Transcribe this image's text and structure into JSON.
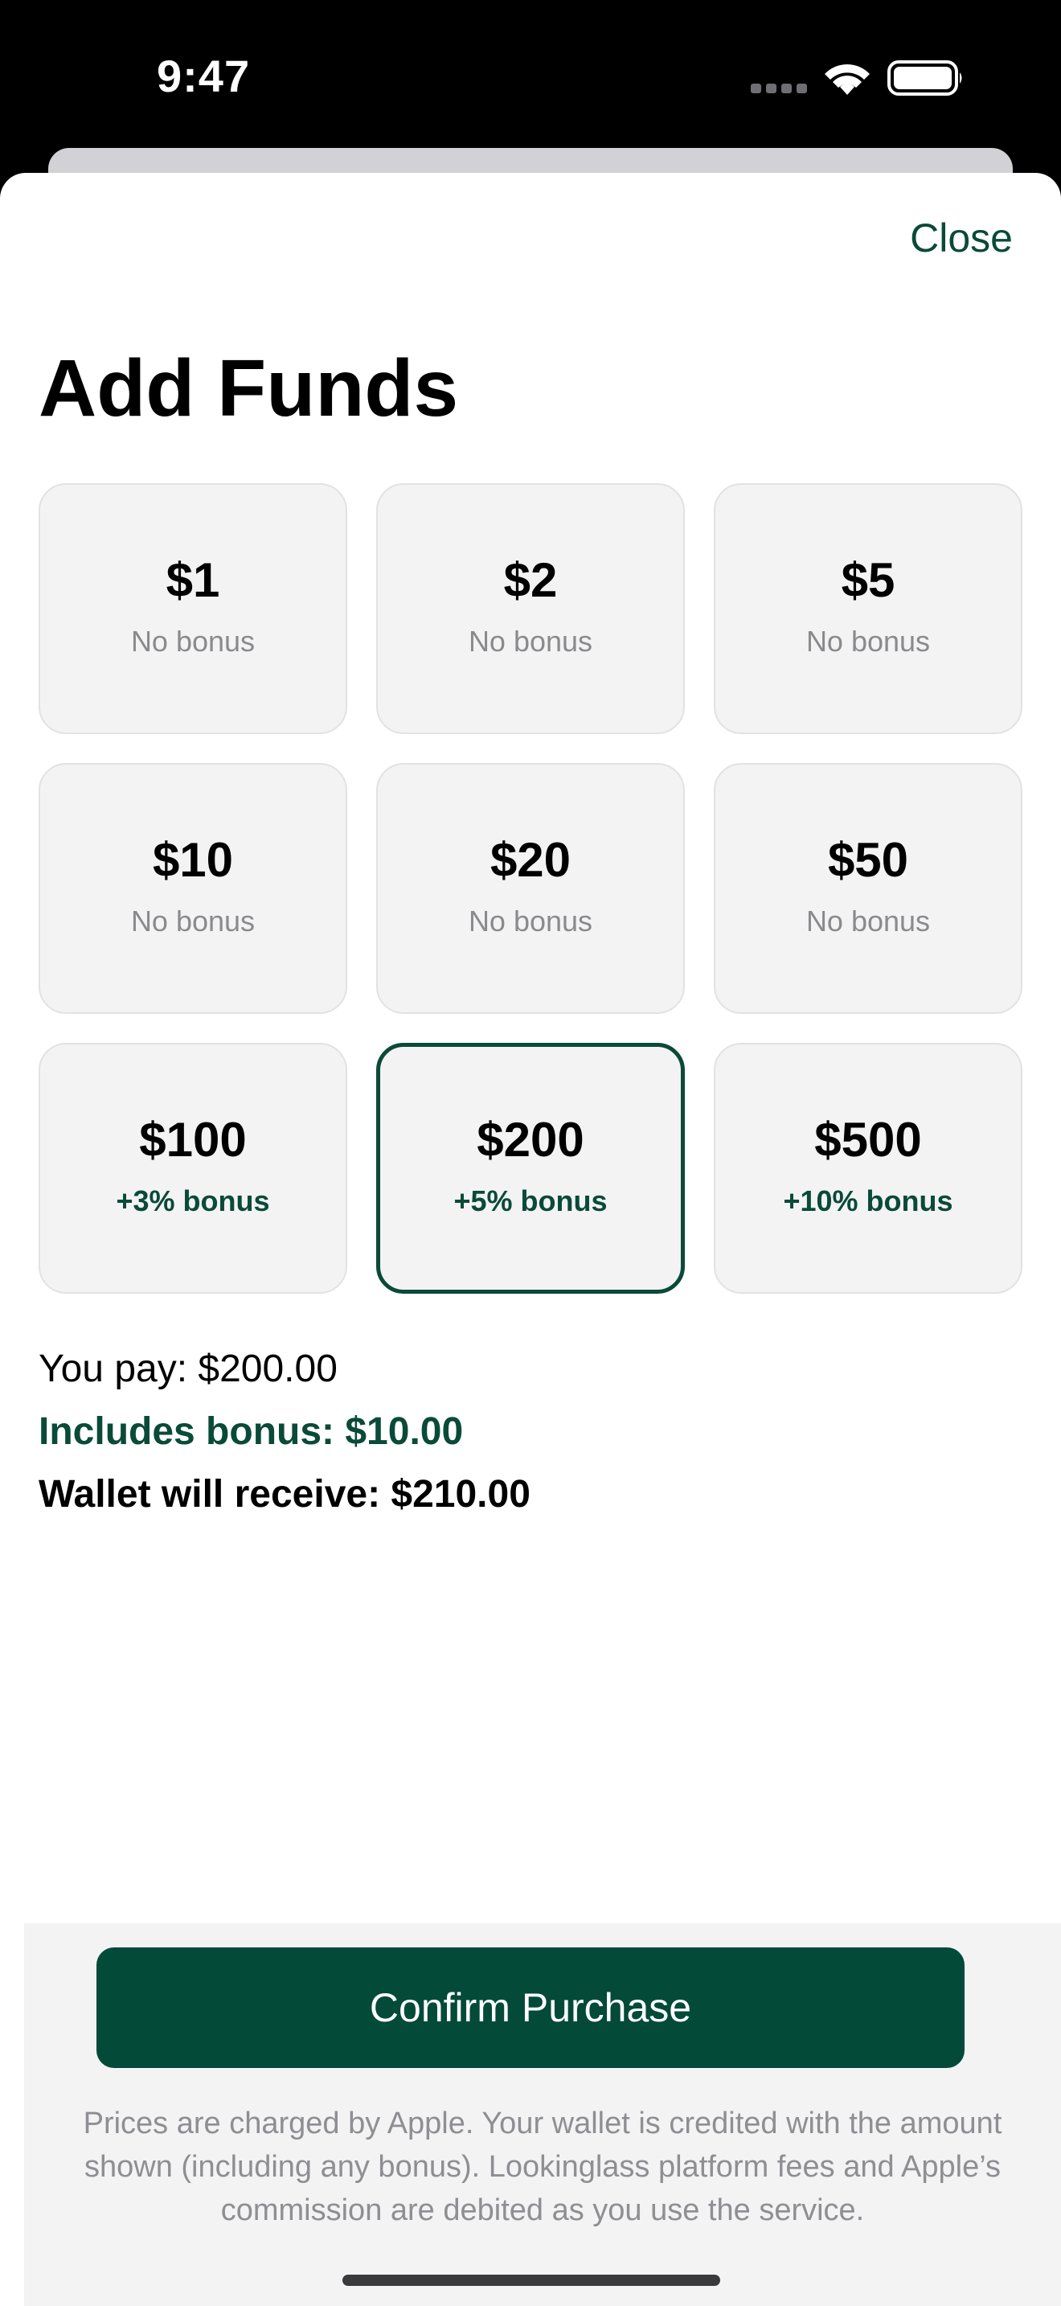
{
  "status_bar": {
    "time": "9:47",
    "icons": [
      "cellular-signal-icon",
      "wifi-icon",
      "battery-icon"
    ]
  },
  "sheet": {
    "close_label": "Close",
    "title": "Add Funds"
  },
  "amount_options": [
    {
      "amount": "$1",
      "bonus": "No bonus",
      "has_bonus": false,
      "selected": false
    },
    {
      "amount": "$2",
      "bonus": "No bonus",
      "has_bonus": false,
      "selected": false
    },
    {
      "amount": "$5",
      "bonus": "No bonus",
      "has_bonus": false,
      "selected": false
    },
    {
      "amount": "$10",
      "bonus": "No bonus",
      "has_bonus": false,
      "selected": false
    },
    {
      "amount": "$20",
      "bonus": "No bonus",
      "has_bonus": false,
      "selected": false
    },
    {
      "amount": "$50",
      "bonus": "No bonus",
      "has_bonus": false,
      "selected": false
    },
    {
      "amount": "$100",
      "bonus": "+3% bonus",
      "has_bonus": true,
      "selected": false
    },
    {
      "amount": "$200",
      "bonus": "+5% bonus",
      "has_bonus": true,
      "selected": true
    },
    {
      "amount": "$500",
      "bonus": "+10% bonus",
      "has_bonus": true,
      "selected": false
    }
  ],
  "summary": {
    "you_pay": "You pay: $200.00",
    "includes_bonus": "Includes bonus: $10.00",
    "wallet_receive": "Wallet will receive: $210.00"
  },
  "footer": {
    "confirm_label": "Confirm Purchase",
    "disclaimer": "Prices are charged by Apple. Your wallet is credited with the amount shown (including any bonus). Lookinglass platform fees and Apple’s commission are debited as you use the service."
  },
  "colors": {
    "accent": "#0a4a38",
    "button": "#034a39",
    "card_bg": "#f3f3f3",
    "muted_text": "#8a8a8e"
  }
}
